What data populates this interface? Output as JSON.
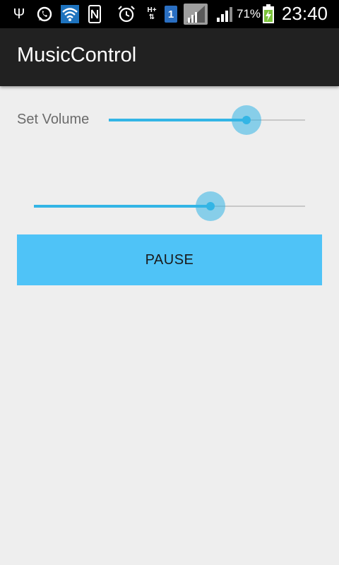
{
  "status_bar": {
    "battery_percent": "71%",
    "clock": "23:40",
    "sim_slot": "1",
    "network_type": "H+",
    "icons": [
      "usb-icon",
      "whatsapp-icon",
      "wifi-icon",
      "nfc-icon",
      "alarm-icon",
      "hplus-data-icon",
      "sim-icon",
      "signal-gray-icon",
      "signal-icon",
      "battery-charging-icon"
    ]
  },
  "action_bar": {
    "title": "MusicControl"
  },
  "volume": {
    "label": "Set Volume",
    "value_fraction": 0.7
  },
  "playback": {
    "progress_fraction": 0.65
  },
  "pause_button": {
    "label": "PAUSE"
  },
  "colors": {
    "accent": "#33b5e5",
    "button": "#4fc3f7",
    "action_bar": "#212121",
    "background": "#eeeeee"
  }
}
